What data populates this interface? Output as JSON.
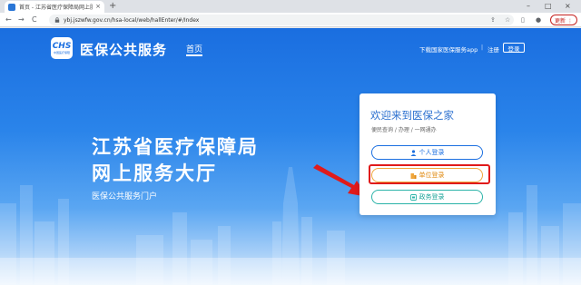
{
  "browser": {
    "tab_title": "首页 - 江苏省医疗保障局网上服务",
    "tab_close": "×",
    "new_tab": "+",
    "window_controls": [
      "–",
      "□",
      "×"
    ],
    "nav": [
      "←",
      "→",
      "C"
    ],
    "url": "ybj.jszwfw.gov.cn/hsa-local/web/hallEnter/#/Index",
    "toolbar_icons": [
      "share-icon",
      "star-icon",
      "sidebar-icon",
      "profile-icon"
    ],
    "update_label": "更新 ⋮"
  },
  "header": {
    "logo_text": "CHS",
    "logo_sub": "中国医疗保障",
    "brand": "医保公共服务",
    "nav_home": "首页",
    "download_app": "下载国家医保服务app",
    "separator": "|",
    "register": "注册",
    "login": "登录"
  },
  "hero": {
    "title_line1": "江苏省医疗保障局",
    "title_line2": "网上服务大厅",
    "subtitle": "医保公共服务门户"
  },
  "login_card": {
    "title": "欢迎来到医保之家",
    "subtitle": "便民查询 / 办理 / 一网通办",
    "personal_login": "个人登录",
    "unit_login": "单位登录",
    "gov_login": "政务登录"
  },
  "colors": {
    "primary_blue": "#1b6fe0",
    "unit_orange": "#f0a63b",
    "gov_teal": "#2bb3a8",
    "annotation_red": "#e01a1a"
  }
}
